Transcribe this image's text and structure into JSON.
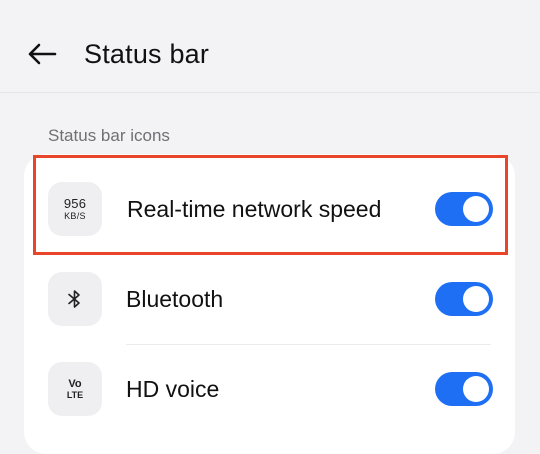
{
  "header": {
    "title": "Status bar",
    "back_icon": "arrow-left-icon"
  },
  "section": {
    "title": "Status bar icons"
  },
  "colors": {
    "accent": "#1f6ff5",
    "highlight": "#e8452a",
    "background": "#f3f3f5",
    "card": "#ffffff"
  },
  "settings": [
    {
      "label": "Real-time network speed",
      "icon": "network-speed-icon",
      "icon_value": "956",
      "icon_unit": "KB/S",
      "enabled": true,
      "highlighted": true
    },
    {
      "label": "Bluetooth",
      "icon": "bluetooth-icon",
      "enabled": true,
      "highlighted": false
    },
    {
      "label": "HD voice",
      "icon": "volte-icon",
      "icon_top": "Vo",
      "icon_bottom": "LTE",
      "enabled": true,
      "highlighted": false
    }
  ]
}
